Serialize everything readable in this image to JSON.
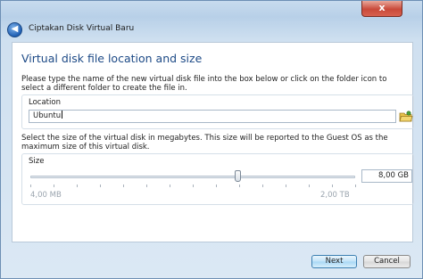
{
  "window": {
    "title": "Ciptakan Disk Virtual Baru",
    "close_glyph": "x",
    "back_icon": "back-arrow-icon"
  },
  "page": {
    "heading": "Virtual disk file location and size",
    "location_description": "Please type the name of the new virtual disk file into the box below or click on the folder icon to select a different folder to create the file in.",
    "size_description": "Select the size of the virtual disk in megabytes. This size will be reported to the Guest OS as the maximum size of this virtual disk."
  },
  "location": {
    "label": "Location",
    "value": "Ubuntu",
    "folder_icon": "folder-icon"
  },
  "size": {
    "label": "Size",
    "value": "8,00 GB",
    "min_label": "4,00 MB",
    "max_label": "2,00 TB",
    "slider_position_fraction": 0.64
  },
  "buttons": {
    "next": "Next",
    "cancel": "Cancel"
  },
  "colors": {
    "heading": "#1d4a86",
    "accent_button_border": "#3c7fb1",
    "close_button": "#c94a3a"
  }
}
